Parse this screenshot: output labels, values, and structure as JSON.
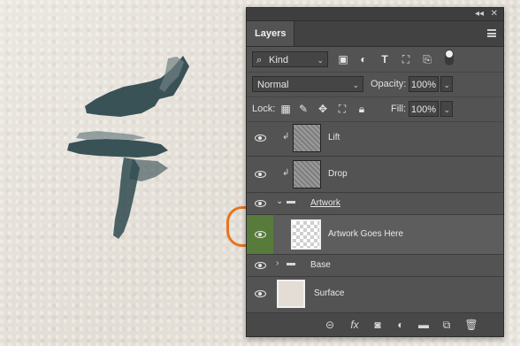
{
  "panel": {
    "tab_label": "Layers",
    "collapse_glyph": "◂◂",
    "close_glyph": "✕"
  },
  "filter": {
    "kind_label": "Kind",
    "search_icon": "⌕"
  },
  "blend": {
    "mode": "Normal",
    "opacity_label": "Opacity:",
    "opacity_value": "100%"
  },
  "lock": {
    "label": "Lock:",
    "fill_label": "Fill:",
    "fill_value": "100%"
  },
  "layers": [
    {
      "name": "Lift",
      "type": "clipped-layer",
      "thumbnail": "texture"
    },
    {
      "name": "Drop",
      "type": "clipped-layer",
      "thumbnail": "texture"
    },
    {
      "name": "Artwork",
      "type": "group",
      "expanded": true
    },
    {
      "name": "Artwork Goes Here",
      "type": "layer",
      "thumbnail": "transparent",
      "selected": true
    },
    {
      "name": "Base",
      "type": "group",
      "expanded": false
    },
    {
      "name": "Surface",
      "type": "layer",
      "thumbnail": "paper"
    }
  ],
  "colors": {
    "highlight": "#e5751f",
    "eye_selected_bg": "#587a3b",
    "paint": "#2f4a4f"
  }
}
